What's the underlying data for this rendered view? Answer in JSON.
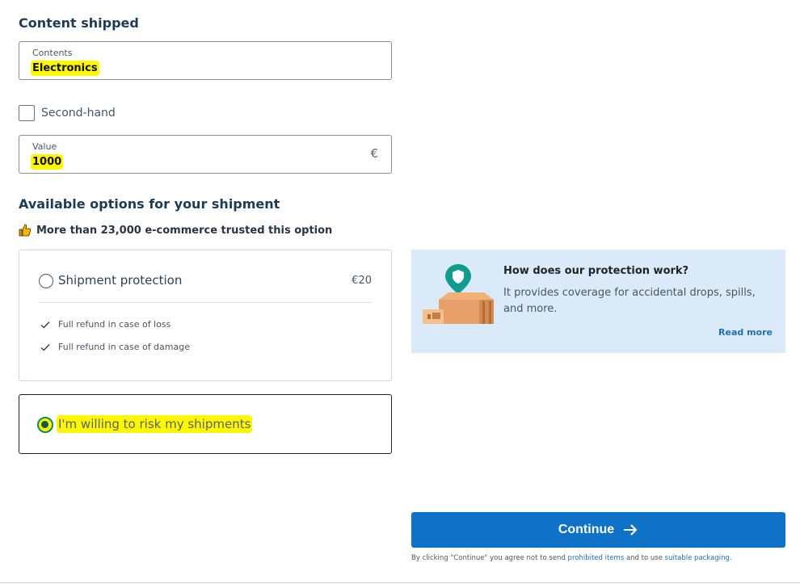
{
  "content_section": {
    "title": "Content shipped",
    "contents_label": "Contents",
    "contents_value": "Electronics",
    "second_hand_label": "Second-hand",
    "second_hand_checked": false,
    "value_label": "Value",
    "value_value": "1000",
    "currency_symbol": "€"
  },
  "options_section": {
    "title": "Available options for your shipment",
    "trusted_text": "More than 23,000 e-commerce trusted this option",
    "protection": {
      "label": "Shipment protection",
      "price": "€20",
      "selected": false,
      "features": [
        "Full refund in case of loss",
        "Full refund in case of damage"
      ]
    },
    "risk": {
      "label": "I'm willing to risk my shipments",
      "selected": true
    }
  },
  "info_box": {
    "title": "How does our protection work?",
    "text": "It provides coverage for accidental drops, spills, and more.",
    "read_more": "Read more"
  },
  "footer": {
    "continue_label": "Continue",
    "legal_prefix": "By clicking \"Continue\" you agree not to send ",
    "legal_link1": "prohibited items",
    "legal_middle": " and to use ",
    "legal_link2": "suitable packaging",
    "legal_suffix": "."
  },
  "colors": {
    "primary": "#0f72c7",
    "heading": "#1f3a55",
    "info_bg": "#dbeaf8",
    "highlight": "#fff700",
    "selected_radio": "#138a5a"
  }
}
